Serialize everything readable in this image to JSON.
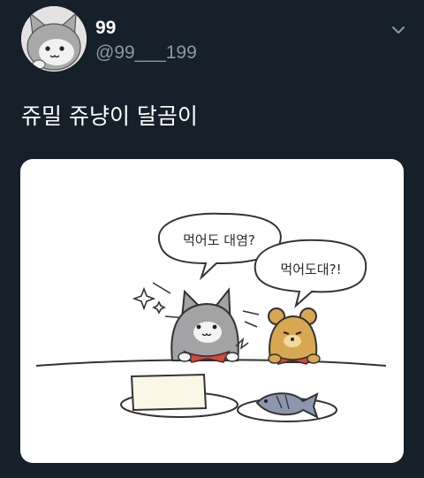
{
  "user": {
    "display_name": "99",
    "handle": "@99___199"
  },
  "tweet": {
    "text": "쥬밀 쥬냥이 달곰이"
  },
  "illustration": {
    "bubble_left": "먹어도 대염?",
    "bubble_right": "먹어도대?!"
  },
  "icons": {
    "more": "chevron-down-icon"
  },
  "colors": {
    "background": "#15202b",
    "handle": "#8899a6",
    "text": "#ffffff"
  }
}
